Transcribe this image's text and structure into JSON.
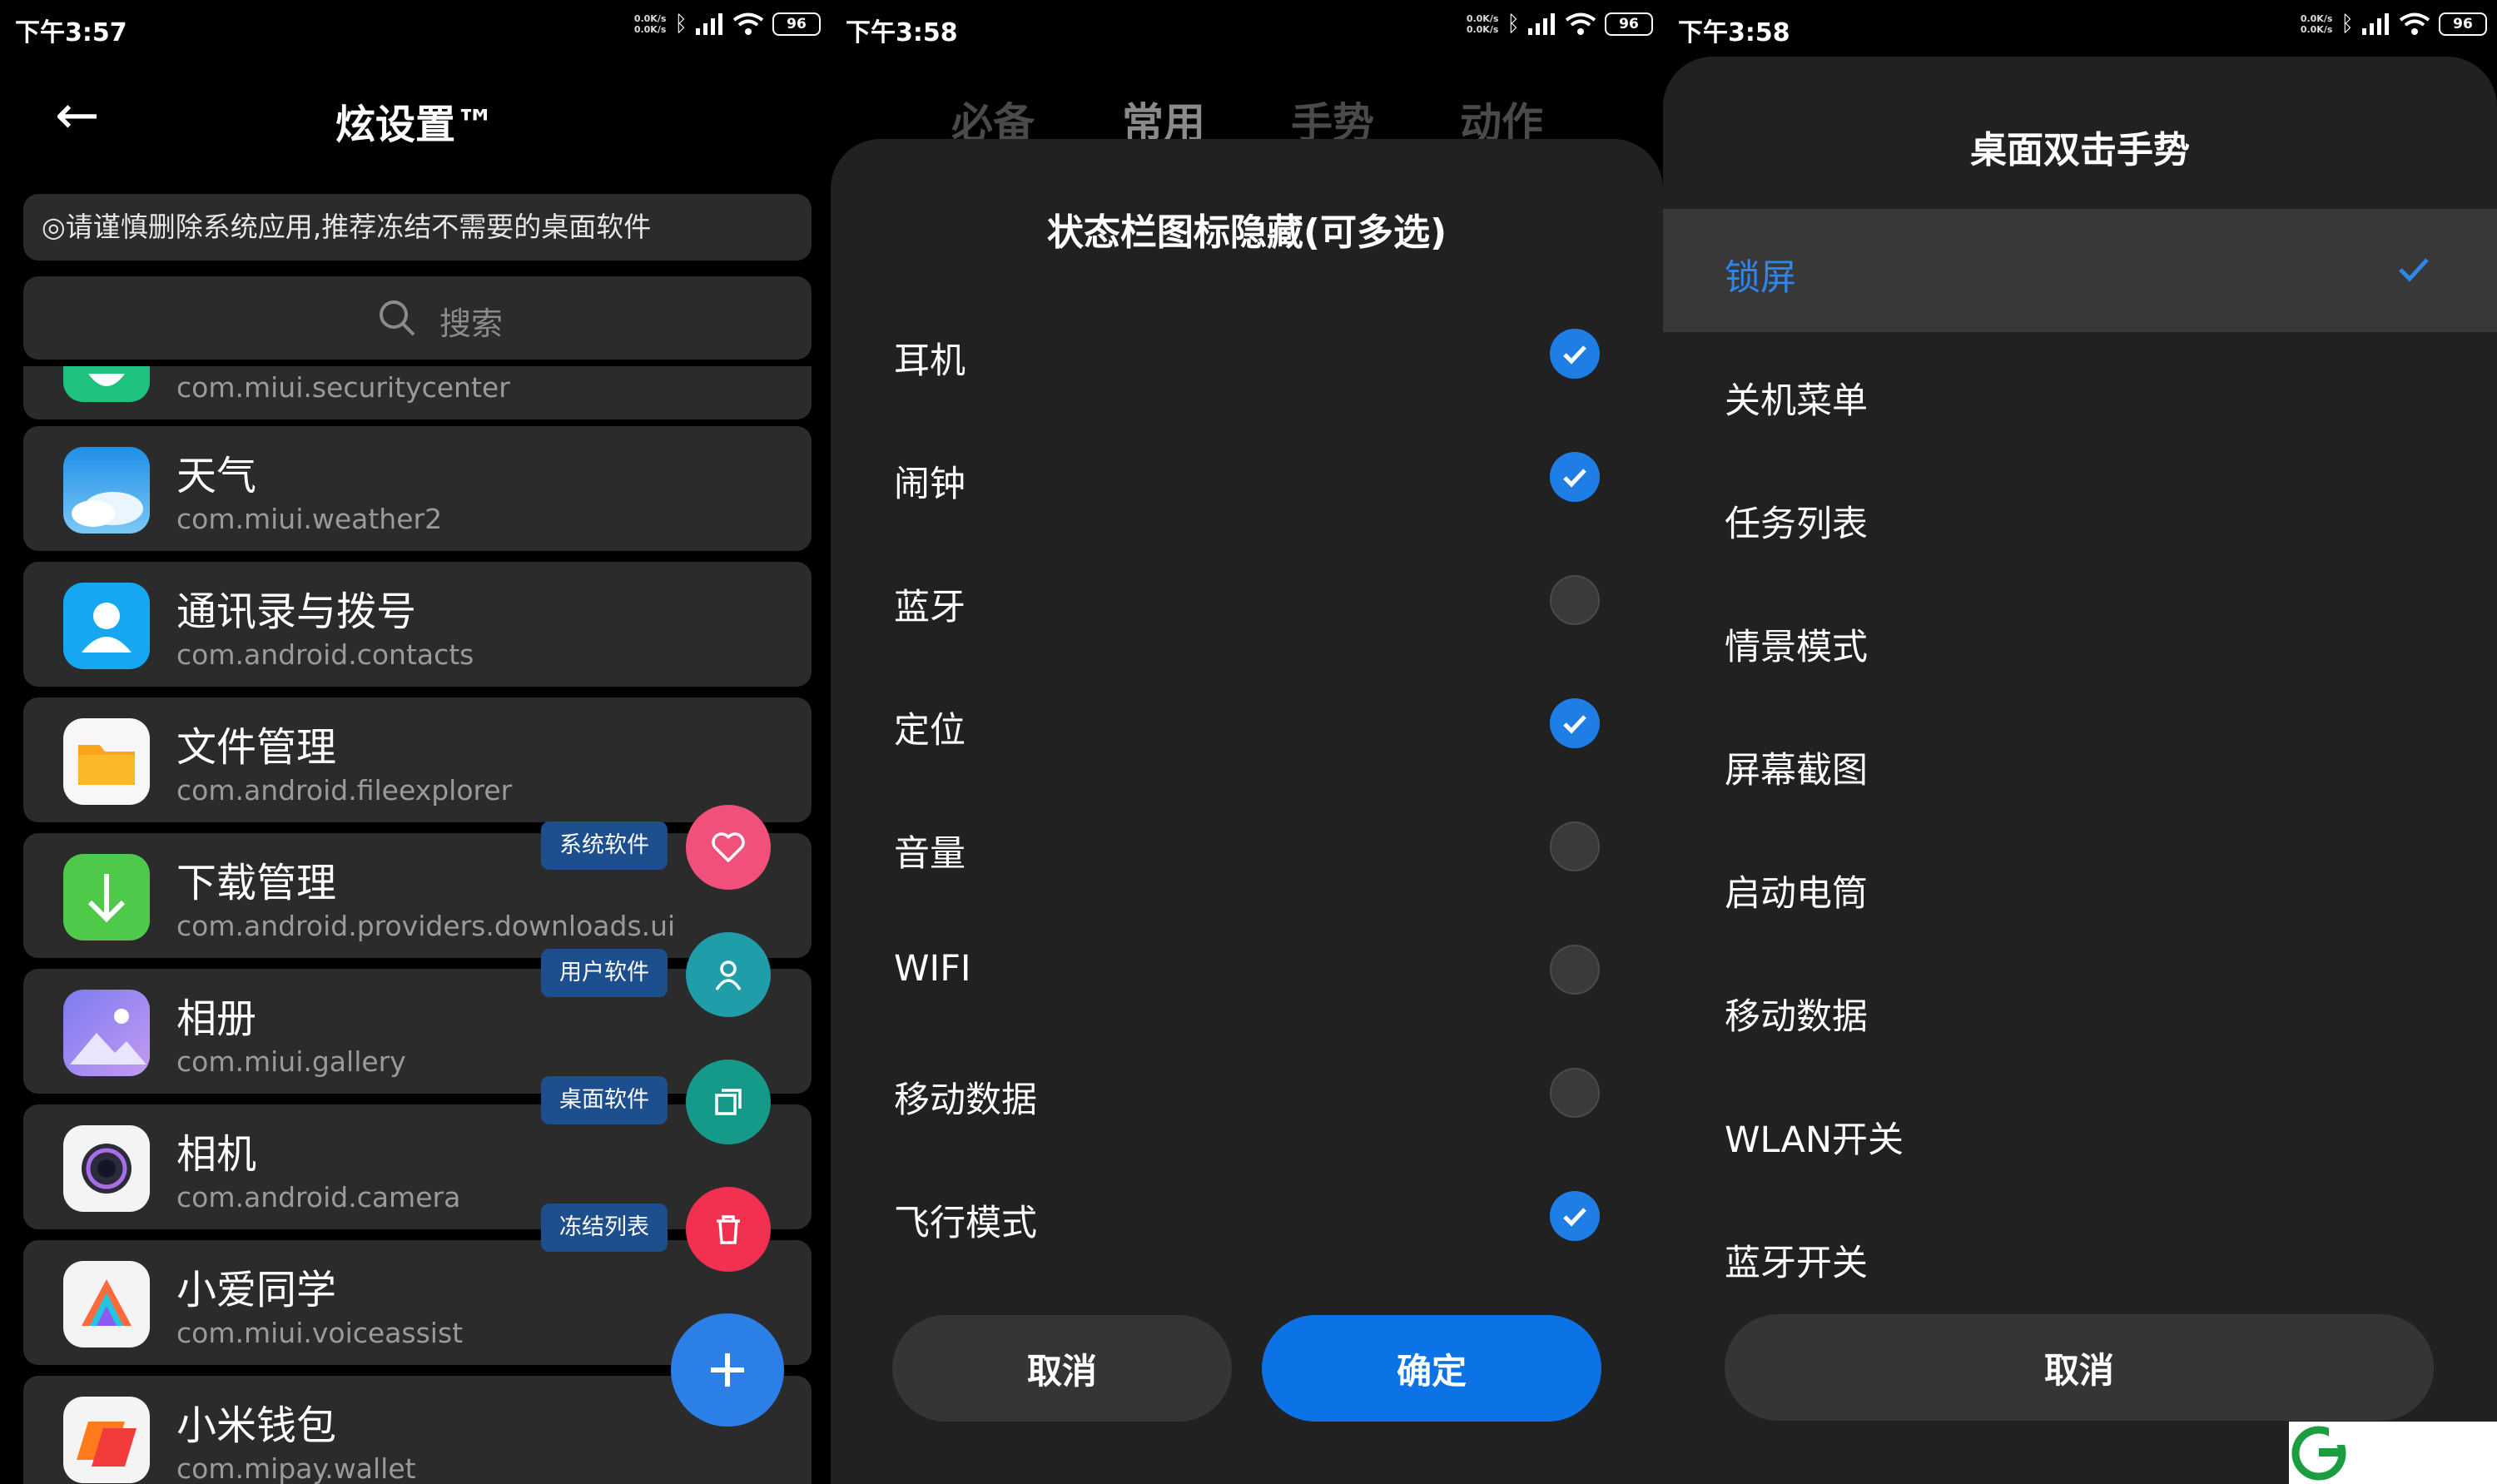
{
  "status_bars": [
    {
      "time": "下午3:57",
      "speed_up": "0.0K/s",
      "speed_down": "0.0K/s",
      "battery": "96"
    },
    {
      "time": "下午3:58",
      "speed_up": "0.0K/s",
      "speed_down": "0.0K/s",
      "battery": "96"
    },
    {
      "time": "下午3:58",
      "speed_up": "0.0K/s",
      "speed_down": "0.0K/s",
      "battery": "96"
    }
  ],
  "panel1": {
    "title": "炫设置™",
    "notice": "◎请谨慎删除系统应用,推荐冻结不需要的桌面软件",
    "search_placeholder": "搜索",
    "apps": [
      {
        "name": "",
        "package": "com.miui.securitycenter",
        "icon": "security-icon"
      },
      {
        "name": "天气",
        "package": "com.miui.weather2",
        "icon": "weather-icon"
      },
      {
        "name": "通讯录与拨号",
        "package": "com.android.contacts",
        "icon": "contacts-icon"
      },
      {
        "name": "文件管理",
        "package": "com.android.fileexplorer",
        "icon": "folder-icon"
      },
      {
        "name": "下载管理",
        "package": "com.android.providers.downloads.ui",
        "icon": "download-icon"
      },
      {
        "name": "相册",
        "package": "com.miui.gallery",
        "icon": "gallery-icon"
      },
      {
        "name": "相机",
        "package": "com.android.camera",
        "icon": "camera-icon"
      },
      {
        "name": "小爱同学",
        "package": "com.miui.voiceassist",
        "icon": "voice-assistant-icon"
      },
      {
        "name": "小米钱包",
        "package": "com.mipay.wallet",
        "icon": "wallet-icon"
      }
    ],
    "fab_menu": [
      {
        "label": "系统软件",
        "icon": "heart-icon",
        "color": "#f0507a"
      },
      {
        "label": "用户软件",
        "icon": "user-icon",
        "color": "#1f9eaa"
      },
      {
        "label": "桌面软件",
        "icon": "copy-icon",
        "color": "#159a8a"
      },
      {
        "label": "冻结列表",
        "icon": "trash-icon",
        "color": "#f2304f"
      }
    ],
    "fab_main_icon": "plus-icon",
    "fab_main_color": "#2d7fe8"
  },
  "panel2": {
    "tabs": [
      {
        "label": "必备",
        "active": false
      },
      {
        "label": "常用",
        "active": true
      },
      {
        "label": "手势",
        "active": false
      },
      {
        "label": "动作",
        "active": false
      }
    ],
    "title": "状态栏图标隐藏(可多选)",
    "options": [
      {
        "label": "耳机",
        "checked": true
      },
      {
        "label": "闹钟",
        "checked": true
      },
      {
        "label": "蓝牙",
        "checked": false
      },
      {
        "label": "定位",
        "checked": true
      },
      {
        "label": "音量",
        "checked": false
      },
      {
        "label": "WIFI",
        "checked": false
      },
      {
        "label": "移动数据",
        "checked": false
      },
      {
        "label": "飞行模式",
        "checked": true
      }
    ],
    "cancel": "取消",
    "confirm": "确定",
    "accent_color": "#1f7de6"
  },
  "panel3": {
    "title": "桌面双击手势",
    "options": [
      {
        "label": "锁屏",
        "selected": true
      },
      {
        "label": "关机菜单",
        "selected": false
      },
      {
        "label": "任务列表",
        "selected": false
      },
      {
        "label": "情景模式",
        "selected": false
      },
      {
        "label": "屏幕截图",
        "selected": false
      },
      {
        "label": "启动电筒",
        "selected": false
      },
      {
        "label": "移动数据",
        "selected": false
      },
      {
        "label": "WLAN开关",
        "selected": false
      },
      {
        "label": "蓝牙开关",
        "selected": false
      }
    ],
    "cancel": "取消",
    "selected_color": "#2e86ea"
  }
}
